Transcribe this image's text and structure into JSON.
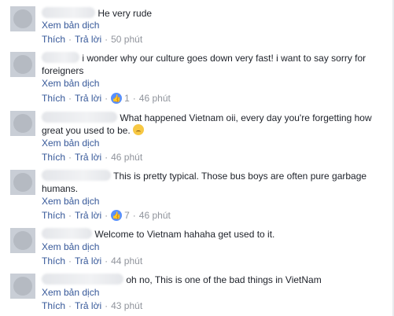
{
  "comments": [
    {
      "text": "He very rude",
      "translate": "Xem bản dịch",
      "like": "Thích",
      "reply": "Trả lời",
      "reactions": "",
      "time": "50 phút"
    },
    {
      "text": "i wonder why our culture goes down very fast! i want to say sorry for foreigners",
      "translate": "Xem bản dịch",
      "like": "Thích",
      "reply": "Trả lời",
      "reactions": "1",
      "time": "46 phút"
    },
    {
      "text": "What happened Vietnam oii, every day you're forgetting how great you used to be.",
      "translate": "Xem bản dịch",
      "like": "Thích",
      "reply": "Trả lời",
      "reactions": "",
      "time": "46 phút"
    },
    {
      "text": "This is pretty typical. Those bus boys are often pure garbage humans.",
      "translate": "Xem bản dịch",
      "like": "Thích",
      "reply": "Trả lời",
      "reactions": "7",
      "time": "46 phút"
    },
    {
      "text": "Welcome to Vietnam hahaha get used to it.",
      "translate": "Xem bản dịch",
      "like": "Thích",
      "reply": "Trả lời",
      "reactions": "",
      "time": "44 phút"
    },
    {
      "text": "oh no, This is one of the bad things in VietNam",
      "translate": "Xem bản dịch",
      "like": "Thích",
      "reply": "Trả lời",
      "reactions": "",
      "time": "43 phút"
    }
  ],
  "icons": {
    "reaction": "like-reaction-icon",
    "emoji": "sad-emoji-icon"
  },
  "colors": {
    "link": "#365899",
    "meta": "#90949c",
    "text": "#1d2129",
    "reaction": "#5890ff"
  }
}
